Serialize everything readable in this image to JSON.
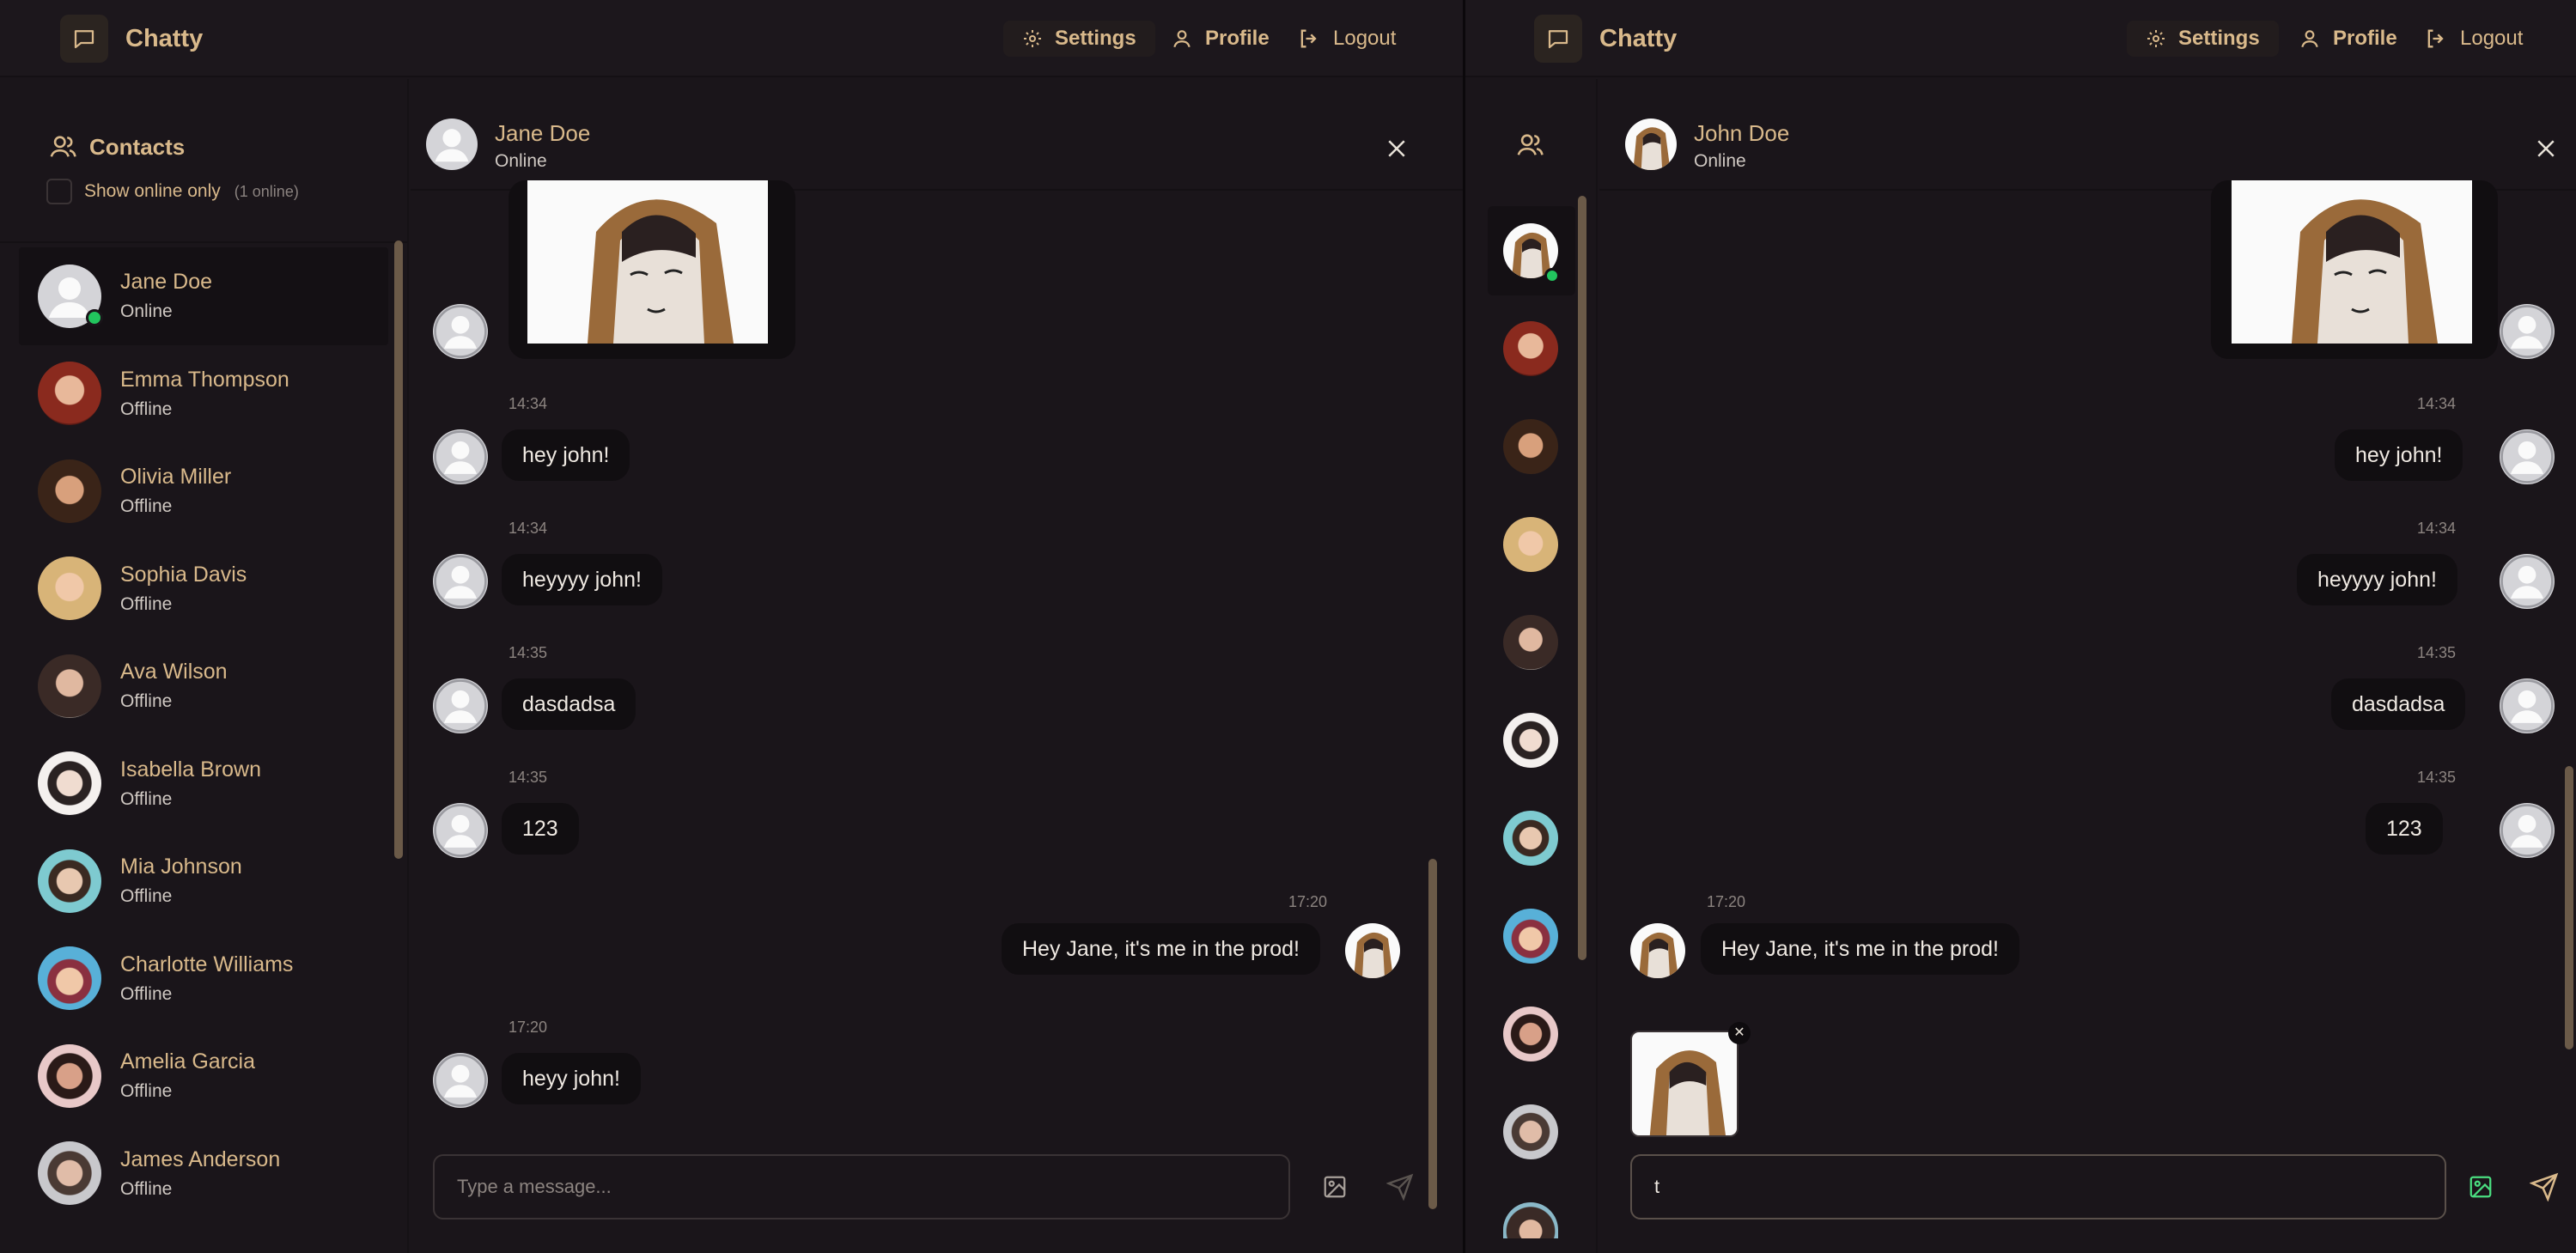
{
  "left": {
    "navbar": {
      "brand": "Chatty",
      "settings": "Settings",
      "profile": "Profile",
      "logout": "Logout"
    },
    "sidebar": {
      "title": "Contacts",
      "filter_label": "Show online only",
      "online_count": "(1 online)",
      "contacts": [
        {
          "name": "Jane Doe",
          "status": "Online"
        },
        {
          "name": "Emma Thompson",
          "status": "Offline"
        },
        {
          "name": "Olivia Miller",
          "status": "Offline"
        },
        {
          "name": "Sophia Davis",
          "status": "Offline"
        },
        {
          "name": "Ava Wilson",
          "status": "Offline"
        },
        {
          "name": "Isabella Brown",
          "status": "Offline"
        },
        {
          "name": "Mia Johnson",
          "status": "Offline"
        },
        {
          "name": "Charlotte Williams",
          "status": "Offline"
        },
        {
          "name": "Amelia Garcia",
          "status": "Offline"
        },
        {
          "name": "James Anderson",
          "status": "Offline"
        }
      ]
    },
    "chat": {
      "name": "Jane Doe",
      "status": "Online",
      "messages": [
        {
          "time": "14:34",
          "text": "hey john!"
        },
        {
          "time": "14:34",
          "text": "heyyyy john!"
        },
        {
          "time": "14:35",
          "text": "dasdadsa"
        },
        {
          "time": "14:35",
          "text": "123"
        },
        {
          "time": "17:20",
          "text": "Hey Jane, it's me in the prod!"
        },
        {
          "time": "17:20",
          "text": "heyy john!"
        }
      ],
      "input_placeholder": "Type a message..."
    }
  },
  "right": {
    "navbar": {
      "brand": "Chatty",
      "settings": "Settings",
      "profile": "Profile",
      "logout": "Logout"
    },
    "chat": {
      "name": "John Doe",
      "status": "Online",
      "messages": [
        {
          "time": "14:34",
          "text": "hey john!"
        },
        {
          "time": "14:34",
          "text": "heyyyy john!"
        },
        {
          "time": "14:35",
          "text": "dasdadsa"
        },
        {
          "time": "14:35",
          "text": "123"
        },
        {
          "time": "17:20",
          "text": "Hey Jane, it's me in the prod!"
        }
      ],
      "preview_remove": "✕",
      "input_value": "t"
    }
  },
  "colors": {
    "accent": "#d9b98b",
    "background": "#1a151a",
    "bubble": "#110e11",
    "online": "#22c55e",
    "image_icon_active": "#4ade80"
  }
}
